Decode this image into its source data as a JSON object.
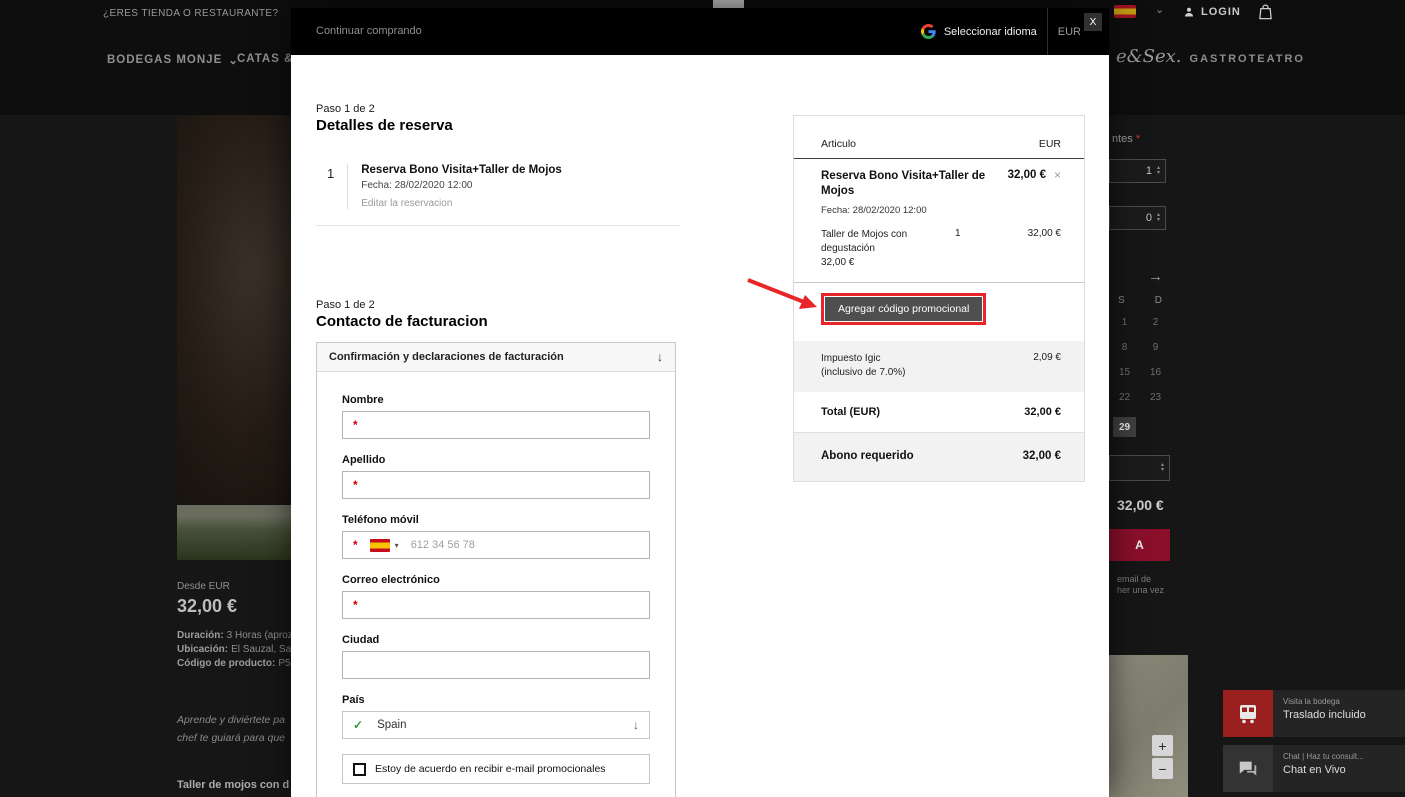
{
  "icons": {
    "chevron_down": "⌄",
    "dropdown_small": "▾",
    "collapse_arrow": "↓",
    "select_arrow": "↓",
    "check": "✓",
    "remove_x": "×",
    "modal_close": "X",
    "stepper_up": "▴",
    "stepper_down": "▾",
    "calendar_next": "→",
    "zoom_in": "+",
    "zoom_out": "−",
    "required_marker": "*"
  },
  "colors": {
    "annotation_red": "#e8262a",
    "promo_button_bg": "#4f4f4f",
    "reserve_button_bg": "#8a0f2b",
    "check_green": "#2e9e44",
    "required_red": "#cc0000"
  },
  "background": {
    "topbar": {
      "question": "¿ERES TIENDA O RESTAURANTE?",
      "login_label": "LOGIN"
    },
    "nav": {
      "brand": "BODEGAS MONJE",
      "item_catas": "CATAS & D",
      "wine_sex": "e&Sex.",
      "gastroteatro": "GASTROTEATRO"
    },
    "product": {
      "desde": "Desde EUR",
      "price": "32,00 €",
      "duracion_label": "Duración:",
      "duracion_value": "3 Horas (aproz",
      "ubicacion_label": "Ubicación:",
      "ubicacion_value": "El Sauzal, Sa",
      "codigo_label": "Código de producto:",
      "codigo_value": "P5",
      "desc_line1": "Aprende y diviértete pa",
      "desc_line2": "chef te guiará para que",
      "section_title": "Taller de mojos con d"
    },
    "booking": {
      "attendees_label": "ntes",
      "attendees_required": "*",
      "stepper1_value": "1",
      "stepper2_value": "0",
      "calendar": {
        "day_headers": [
          "S",
          "D"
        ],
        "rows": [
          [
            "1",
            "2"
          ],
          [
            "8",
            "9"
          ],
          [
            "15",
            "16"
          ],
          [
            "22",
            "23"
          ],
          [
            "29",
            ""
          ]
        ],
        "selected_day": "29"
      },
      "price": "32,00 €",
      "reserve_label": "A",
      "note_line1": "email de",
      "note_line2": "her una vez"
    },
    "widgets": {
      "visita_title": "Visita la bodega",
      "visita_subtitle": "Traslado incluido",
      "chat_title": "Chat | Haz tu consult...",
      "chat_subtitle": "Chat en Vivo"
    }
  },
  "modal": {
    "topbar": {
      "continue_shopping": "Continuar comprando",
      "select_language": "Seleccionar idioma",
      "currency": "EUR"
    },
    "reservation": {
      "step": "Paso 1 de 2",
      "title": "Detalles de reserva",
      "item_number": "1",
      "item_title": "Reserva Bono Visita+Taller de Mojos",
      "item_date": "Fecha: 28/02/2020  12:00",
      "edit_link": "Editar la reservacion"
    },
    "billing": {
      "step": "Paso 1 de 2",
      "title": "Contacto de facturacion",
      "panel_title": "Confirmación y declaraciones de facturación",
      "nombre_label": "Nombre",
      "apellido_label": "Apellido",
      "telefono_label": "Teléfono móvil",
      "telefono_placeholder": "612 34 56 78",
      "correo_label": "Correo electrónico",
      "ciudad_label": "Ciudad",
      "pais_label": "País",
      "pais_value": "Spain",
      "checkbox_label": "Estoy de acuerdo en recibir e-mail promocionales"
    },
    "summary": {
      "header_item": "Articulo",
      "header_currency": "EUR",
      "item_title": "Reserva Bono Visita+Taller de Mojos",
      "item_price": "32,00 €",
      "item_date": "Fecha: 28/02/2020  12:00",
      "line_item_name": "Taller de Mojos con degustación",
      "line_item_unit_price": "32,00 €",
      "line_item_qty": "1",
      "line_item_total": "32,00 €",
      "promo_button": "Agregar código promocional",
      "tax_label": "Impuesto Igic",
      "tax_note": "(inclusivo de 7.0%)",
      "tax_value": "2,09 €",
      "total_label": "Total (EUR)",
      "total_value": "32,00 €",
      "due_label": "Abono requerido",
      "due_value": "32,00 €"
    }
  }
}
